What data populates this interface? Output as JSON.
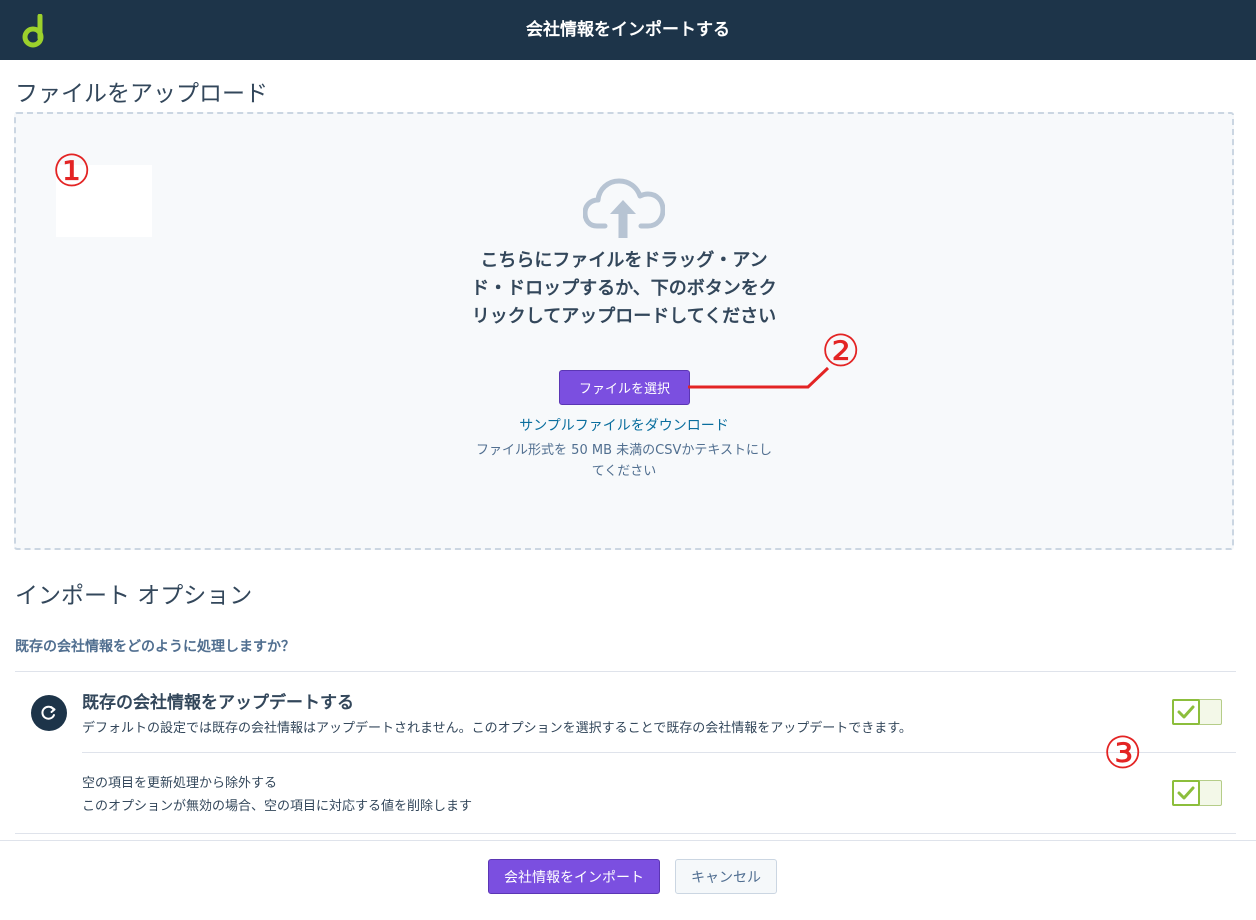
{
  "header": {
    "title": "会社情報をインポートする",
    "logo_icon": "sprocket-logo-icon",
    "background_color": "#1d3449"
  },
  "upload": {
    "heading": "ファイルをアップロード",
    "dropzone_icon": "cloud-upload-icon",
    "drop_text": "こちらにファイルをドラッグ・アンド・ドロップするか、下のボタンをクリックしてアップロードしてください",
    "choose_button_label": "ファイルを選択",
    "sample_link_label": "サンプルファイルをダウンロード",
    "format_note": "ファイル形式を 50 MB 未満のCSVかテキストにしてください"
  },
  "options": {
    "heading": "インポート オプション",
    "question": "既存の会社情報をどのように処理しますか？",
    "option_icon": "refresh-icon",
    "items": [
      {
        "title": "既存の会社情報をアップデートする",
        "description": "デフォルトの設定では既存の会社情報はアップデートされません。このオプションを選択することで既存の会社情報をアップデートできます。",
        "enabled": true
      },
      {
        "title": "空の項目を更新処理から除外する",
        "description": "このオプションが無効の場合、空の項目に対応する値を削除します",
        "enabled": true
      }
    ]
  },
  "footer": {
    "import_button_label": "会社情報をインポート",
    "cancel_button_label": "キャンセル"
  },
  "annotations": {
    "markers": [
      "①",
      "②",
      "③"
    ],
    "color": "#e32424"
  },
  "colors": {
    "accent": "#7b4fe0",
    "toggle_on": "#8cbe3c",
    "link": "#0a6e9e",
    "text": "#33475b"
  }
}
